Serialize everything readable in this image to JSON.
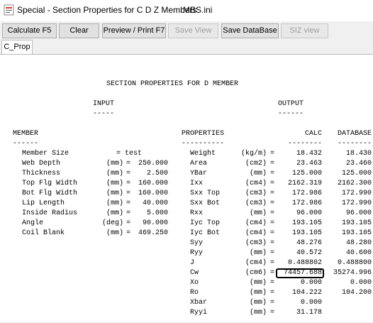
{
  "window": {
    "title": "Special - Section Properties for C D Z Members",
    "filename": "MBS.ini"
  },
  "toolbar": {
    "calculate_label": "Calculate  F5",
    "clear_label": "Clear",
    "preview_label": "Preview / Print F7",
    "save_view_label": "Save View",
    "save_database_label": "Save DataBase",
    "siz_view_label": "SIZ view"
  },
  "tabs": [
    {
      "label": "C_Prop"
    }
  ],
  "report": {
    "title": "SECTION PROPERTIES FOR D MEMBER",
    "input_heading": "INPUT",
    "input_underline": "-----",
    "output_heading": "OUTPUT",
    "output_underline": "------",
    "member_heading": "MEMBER",
    "member_underline": "------",
    "properties_heading": "PROPERTIES",
    "properties_underline": "----------",
    "calc_heading": "CALC",
    "calc_underline": "--------",
    "database_heading": "DATABASE",
    "database_underline": "--------",
    "member_rows": [
      {
        "label": "Member Size",
        "unit": "",
        "eq": "=",
        "value": "test"
      },
      {
        "label": "Web Depth",
        "unit": "(mm)",
        "eq": "=",
        "value": "250.000"
      },
      {
        "label": "Thickness",
        "unit": "(mm)",
        "eq": "=",
        "value": "2.500"
      },
      {
        "label": "Top Flg Width",
        "unit": "(mm)",
        "eq": "=",
        "value": "160.000"
      },
      {
        "label": "Bot Flg Width",
        "unit": "(mm)",
        "eq": "=",
        "value": "160.000"
      },
      {
        "label": "Lip Length",
        "unit": "(mm)",
        "eq": "=",
        "value": "40.000"
      },
      {
        "label": "Inside Radius",
        "unit": "(mm)",
        "eq": "=",
        "value": "5.000"
      },
      {
        "label": "Angle",
        "unit": "(deg)",
        "eq": "=",
        "value": "90.000"
      },
      {
        "label": "Coil Blank",
        "unit": "(mm)",
        "eq": "=",
        "value": "469.250"
      }
    ],
    "property_rows": [
      {
        "label": "Weight",
        "unit": "(kg/m)",
        "eq": "=",
        "calc": "18.432",
        "database": "18.430"
      },
      {
        "label": "Area",
        "unit": "(cm2)",
        "eq": "=",
        "calc": "23.463",
        "database": "23.460"
      },
      {
        "label": "YBar",
        "unit": "(mm)",
        "eq": "=",
        "calc": "125.000",
        "database": "125.000"
      },
      {
        "label": "Ixx",
        "unit": "(cm4)",
        "eq": "=",
        "calc": "2162.319",
        "database": "2162.300"
      },
      {
        "label": "Sxx Top",
        "unit": "(cm3)",
        "eq": "=",
        "calc": "172.986",
        "database": "172.990"
      },
      {
        "label": "Sxx Bot",
        "unit": "(cm3)",
        "eq": "=",
        "calc": "172.986",
        "database": "172.990"
      },
      {
        "label": "Rxx",
        "unit": "(mm)",
        "eq": "=",
        "calc": "96.000",
        "database": "96.000"
      },
      {
        "label": "Iyc Top",
        "unit": "(cm4)",
        "eq": "=",
        "calc": "193.105",
        "database": "193.105"
      },
      {
        "label": "Iyc Bot",
        "unit": "(cm4)",
        "eq": "=",
        "calc": "193.105",
        "database": "193.105"
      },
      {
        "label": "Syy",
        "unit": "(cm3)",
        "eq": "=",
        "calc": "48.276",
        "database": "48.280"
      },
      {
        "label": "Ryy",
        "unit": "(mm)",
        "eq": "=",
        "calc": "40.572",
        "database": "40.600"
      },
      {
        "label": "J",
        "unit": "(cm4)",
        "eq": "=",
        "calc": "0.488802",
        "database": "0.488800"
      },
      {
        "label": "Cw",
        "unit": "(cm6)",
        "eq": "=",
        "calc": "74457.688",
        "database": "35274.996"
      },
      {
        "label": "Xo",
        "unit": "(mm)",
        "eq": "=",
        "calc": "0.000",
        "database": "0.000"
      },
      {
        "label": "Ro",
        "unit": "(mm)",
        "eq": "=",
        "calc": "104.222",
        "database": "104.200"
      },
      {
        "label": "Xbar",
        "unit": "(mm)",
        "eq": "=",
        "calc": "0.000",
        "database": ""
      },
      {
        "label": "Ryyi",
        "unit": "(mm)",
        "eq": "=",
        "calc": "31.178",
        "database": ""
      }
    ]
  }
}
